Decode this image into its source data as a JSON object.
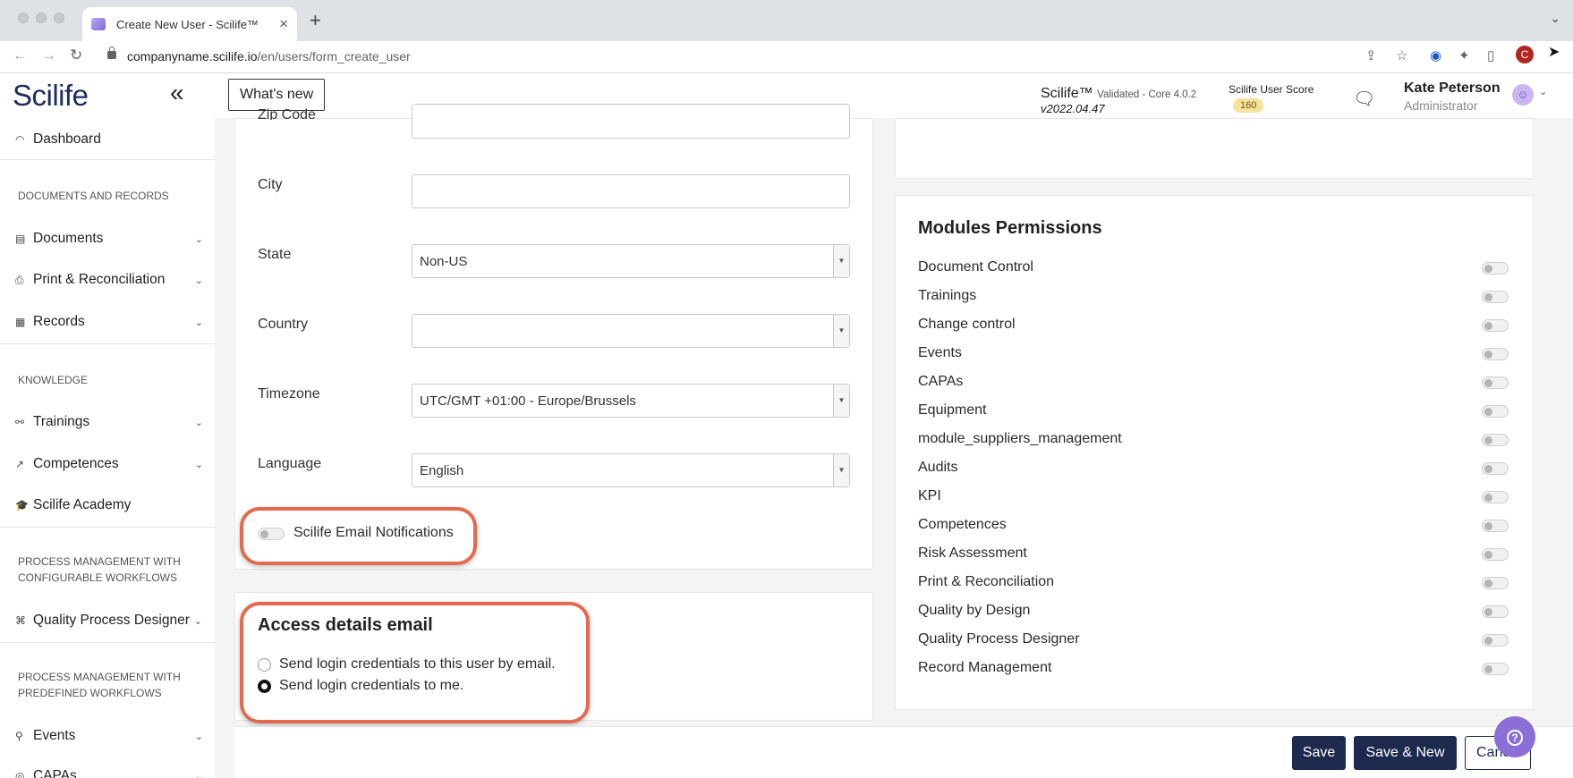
{
  "browser": {
    "tab_title": "Create New User - Scilife™",
    "url_host": "companyname.scilife.io",
    "url_path": "/en/users/form_create_user",
    "profile_initial": "C"
  },
  "header": {
    "logo": "Scilife",
    "whats_new": "What's new",
    "product": "Scilife™",
    "validated": "Validated - Core 4.0.2",
    "version": "v2022.04.47",
    "score_label": "Scilife User Score",
    "score_value": "160",
    "user_name": "Kate Peterson",
    "user_role": "Administrator"
  },
  "sidebar": {
    "dashboard": "Dashboard",
    "section_docs": "DOCUMENTS AND RECORDS",
    "documents": "Documents",
    "print": "Print & Reconciliation",
    "records": "Records",
    "section_knowledge": "KNOWLEDGE",
    "trainings": "Trainings",
    "competences": "Competences",
    "academy": "Scilife Academy",
    "section_configurable": "PROCESS MANAGEMENT WITH CONFIGURABLE WORKFLOWS",
    "qpd": "Quality Process Designer",
    "section_predefined": "PROCESS MANAGEMENT WITH PREDEFINED WORKFLOWS",
    "events": "Events",
    "capas": "CAPAs"
  },
  "form": {
    "zip_label": "Zip Code",
    "city_label": "City",
    "state_label": "State",
    "state_value": "Non-US",
    "country_label": "Country",
    "country_value": "",
    "timezone_label": "Timezone",
    "timezone_value": "UTC/GMT +01:00 - Europe/Brussels",
    "language_label": "Language",
    "language_value": "English",
    "email_notifications": "Scilife Email Notifications"
  },
  "access": {
    "title": "Access details email",
    "option_user": "Send login credentials to this user by email.",
    "option_me": "Send login credentials to me.",
    "selected": "option_me"
  },
  "permissions": {
    "title": "Modules Permissions",
    "items": [
      "Document Control",
      "Trainings",
      "Change control",
      "Events",
      "CAPAs",
      "Equipment",
      "module_suppliers_management",
      "Audits",
      "KPI",
      "Competences",
      "Risk Assessment",
      "Print & Reconciliation",
      "Quality by Design",
      "Quality Process Designer",
      "Record Management"
    ]
  },
  "actions": {
    "save": "Save",
    "save_new": "Save & New",
    "cancel": "Cancel"
  },
  "colors": {
    "highlight": "#e46a4f",
    "primary": "#1d2a4d",
    "help": "#8b6fd6",
    "score_badge": "#f7e19b"
  }
}
